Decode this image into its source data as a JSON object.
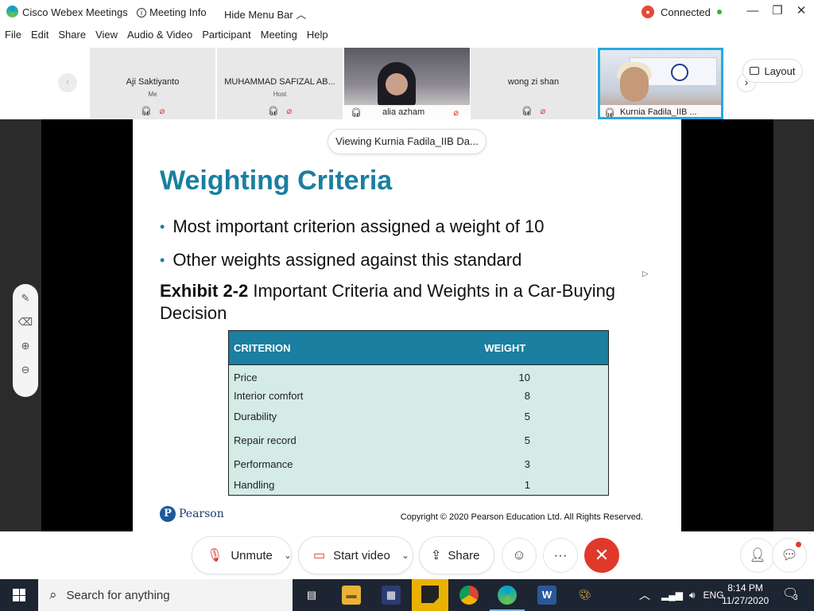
{
  "window": {
    "app_title": "Cisco Webex Meetings",
    "meeting_info": "Meeting Info",
    "hide_menu_bar": "Hide Menu Bar",
    "status": "Connected",
    "minimize_icon": "minimize-icon",
    "maximize_icon": "restore-icon",
    "close_icon": "close-icon"
  },
  "menu": [
    "File",
    "Edit",
    "Share",
    "View",
    "Audio & Video",
    "Participant",
    "Meeting",
    "Help"
  ],
  "participants": [
    {
      "name": "Aji Saktiyanto",
      "sub": "Me"
    },
    {
      "name": "MUHAMMAD SAFIZAL AB...",
      "sub": "Host"
    },
    {
      "name": "alia azham",
      "sub": ""
    },
    {
      "name": "wong zi shan",
      "sub": ""
    },
    {
      "name": "Kurnia Fadila_IIB ...",
      "sub": ""
    }
  ],
  "video_banner_text": "UNIVERSITI\nMALAYSIA\nPAHANG",
  "layout_button": "Layout",
  "viewing_label": "Viewing Kurnia Fadila_IIB Da...",
  "slide": {
    "title": "Weighting Criteria",
    "bullets": [
      "Most important criterion assigned a weight of 10",
      "Other weights assigned against this standard"
    ],
    "exhibit_label": "Exhibit 2-2",
    "exhibit_text": " Important Criteria and Weights in a Car-Buying Decision",
    "table": {
      "headers": [
        "CRITERION",
        "WEIGHT"
      ],
      "rows": [
        [
          "Price",
          "10"
        ],
        [
          "Interior comfort",
          "8"
        ],
        [
          "Durability",
          "5"
        ],
        [
          "Repair record",
          "5"
        ],
        [
          "Performance",
          "3"
        ],
        [
          "Handling",
          "1"
        ]
      ]
    },
    "publisher": "Pearson",
    "copyright": "Copyright © 2020 Pearson Education Ltd. All Rights Reserved."
  },
  "controls": {
    "unmute": "Unmute",
    "start_video": "Start video",
    "share": "Share",
    "more": "···"
  },
  "taskbar": {
    "search_placeholder": "Search for anything",
    "language": "ENG",
    "time": "8:14 PM",
    "date": "11/27/2020",
    "notifications": "3"
  },
  "colors": {
    "accent": "#1a7fa0",
    "table_body": "#d4ebe6",
    "end_call": "#e0392b",
    "active_speaker": "#29a8e0"
  }
}
